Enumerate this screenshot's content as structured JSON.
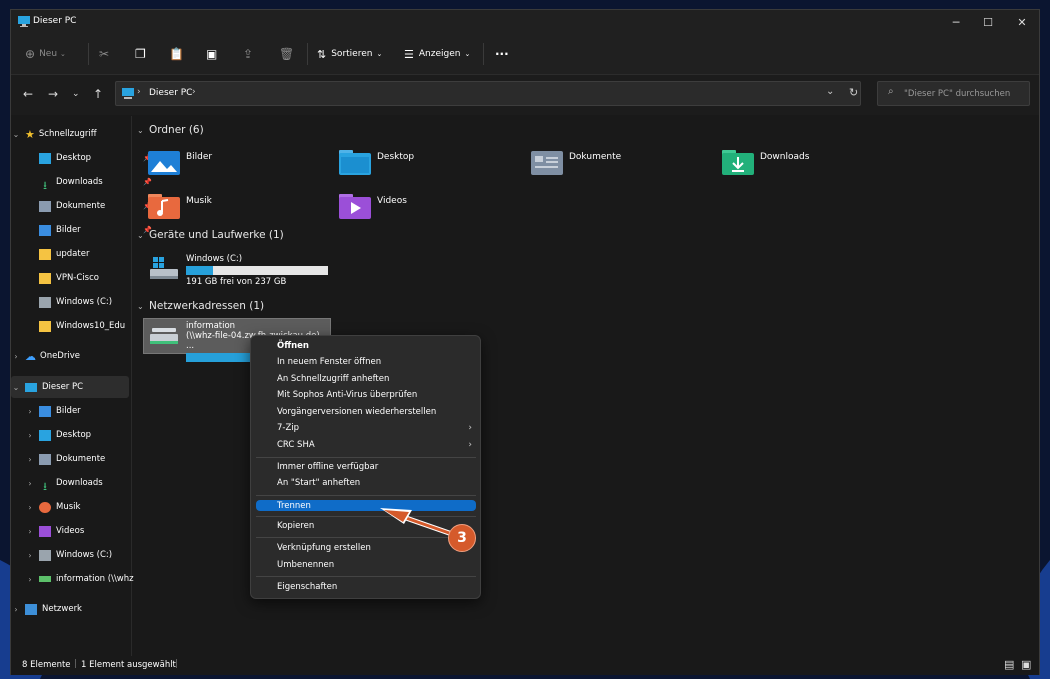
{
  "window": {
    "title": "Dieser PC"
  },
  "toolbar": {
    "new_label": "Neu",
    "sort_label": "Sortieren",
    "view_label": "Anzeigen",
    "more_label": "···"
  },
  "address": {
    "path": "Dieser PC",
    "sep": "›"
  },
  "search": {
    "placeholder": "\"Dieser PC\" durchsuchen"
  },
  "sidebar": {
    "quick": {
      "label": "Schnellzugriff",
      "items": [
        "Desktop",
        "Downloads",
        "Dokumente",
        "Bilder",
        "updater",
        "VPN-Cisco",
        "Windows (C:)",
        "Windows10_Edu"
      ]
    },
    "onedrive": "OneDrive",
    "thispc": {
      "label": "Dieser PC",
      "items": [
        "Bilder",
        "Desktop",
        "Dokumente",
        "Downloads",
        "Musik",
        "Videos",
        "Windows (C:)",
        "information (\\\\whz"
      ]
    },
    "network": "Netzwerk"
  },
  "main": {
    "folders_header": "Ordner (6)",
    "folders": [
      "Bilder",
      "Desktop",
      "Dokumente",
      "Downloads",
      "Musik",
      "Videos"
    ],
    "drives_header": "Geräte und Laufwerke (1)",
    "drive": {
      "name": "Windows (C:)",
      "free": "191 GB frei von 237 GB",
      "used_fraction": 0.19
    },
    "net_header": "Netzwerkadressen (1)",
    "netdrive": {
      "name": "information",
      "path": "(\\\\whz-file-04.zw.fh-zwickau.de) ...",
      "used_fraction": 0.46
    }
  },
  "context_menu": {
    "items": [
      "Öffnen",
      "In neuem Fenster öffnen",
      "An Schnellzugriff anheften",
      "Mit Sophos Anti-Virus überprüfen",
      "Vorgängerversionen wiederherstellen",
      "7-Zip",
      "CRC SHA",
      "Immer offline verfügbar",
      "An \"Start\" anheften",
      "Trennen",
      "Kopieren",
      "Verknüpfung erstellen",
      "Umbenennen",
      "Eigenschaften"
    ],
    "highlighted": "Trennen"
  },
  "callout": {
    "number": "3",
    "color": "#d55a2b"
  },
  "status": {
    "count": "8 Elemente",
    "selected": "1 Element ausgewählt"
  },
  "colors": {
    "accent": "#0f6cc8",
    "bar": "#26a0da"
  }
}
